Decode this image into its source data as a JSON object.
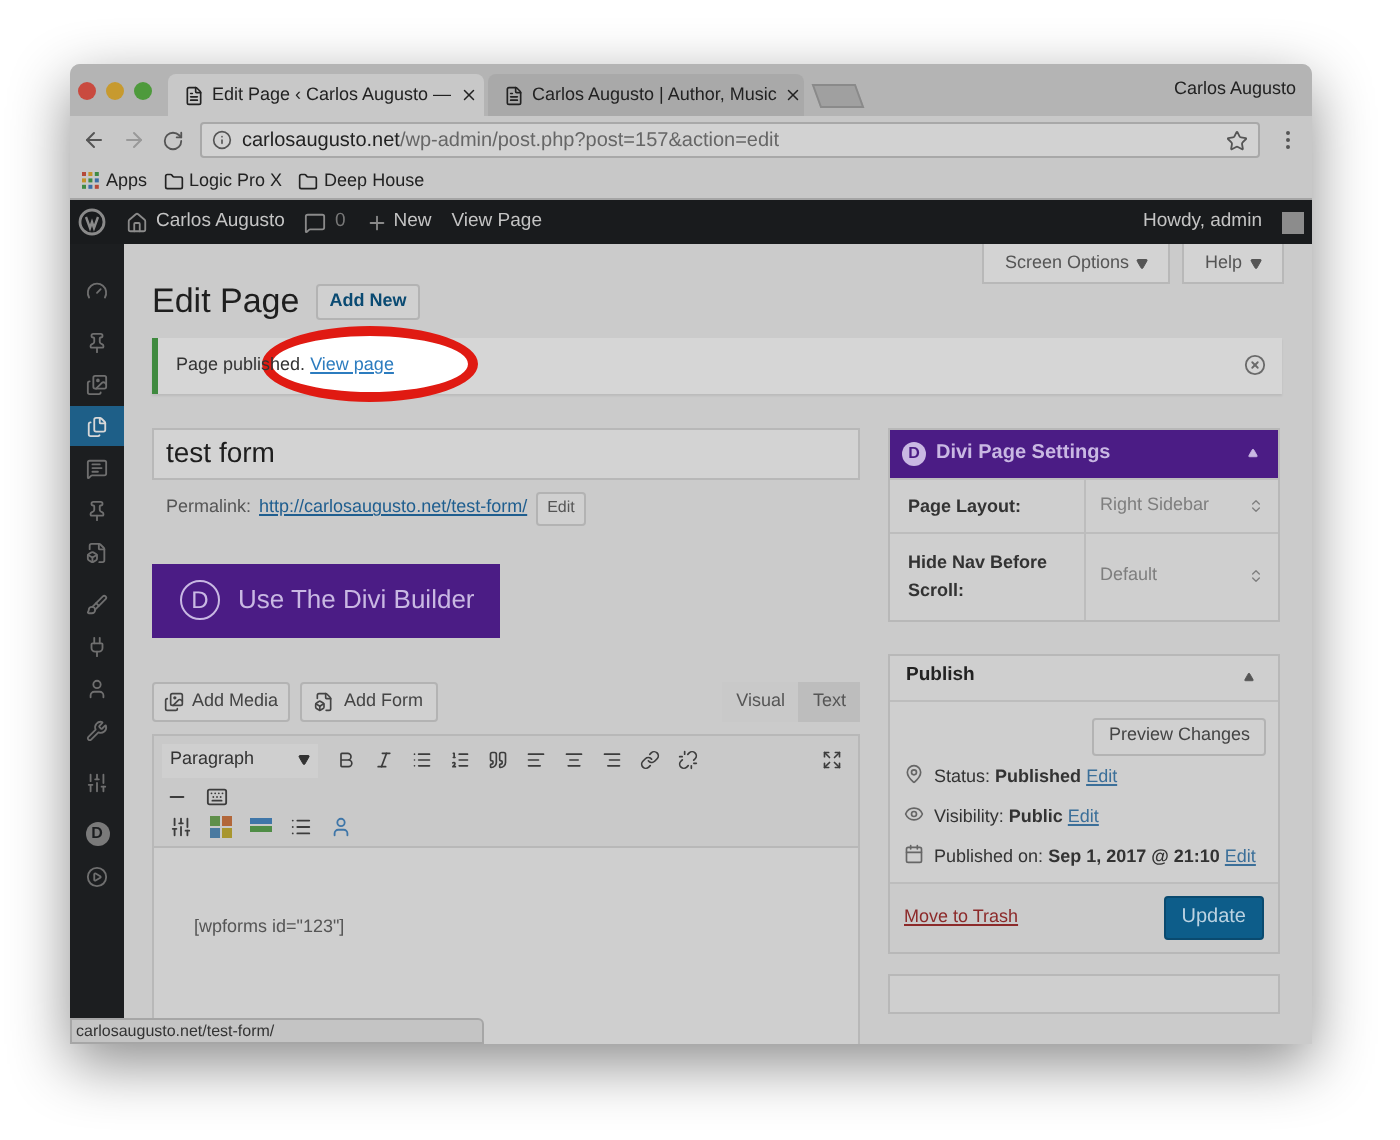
{
  "browser": {
    "tabs": [
      {
        "title": "Edit Page ‹ Carlos Augusto —",
        "selected": true
      },
      {
        "title": "Carlos Augusto | Author, Music",
        "selected": false
      }
    ],
    "profile_name": "Carlos Augusto",
    "url": {
      "domain": "carlosaugusto.net",
      "path": "/wp-admin/post.php?post=157&action=edit"
    },
    "bookmarks": [
      {
        "label": "Apps",
        "kind": "apps"
      },
      {
        "label": "Logic Pro X",
        "kind": "folder"
      },
      {
        "label": "Deep House",
        "kind": "folder"
      }
    ]
  },
  "admin_bar": {
    "site_name": "Carlos Augusto",
    "comments_count": "0",
    "new_label": "New",
    "view_page": "View Page",
    "greeting": "Howdy, admin"
  },
  "admin_menu": [
    {
      "kind": "dashboard",
      "selected": false
    },
    {
      "kind": "pin",
      "selected": false
    },
    {
      "kind": "media",
      "selected": false
    },
    {
      "kind": "pages",
      "selected": true
    },
    {
      "kind": "comments",
      "selected": false
    },
    {
      "kind": "pin",
      "selected": false
    },
    {
      "kind": "form",
      "selected": false
    },
    {
      "kind": "appearance",
      "selected": false
    },
    {
      "kind": "plugins",
      "selected": false
    },
    {
      "kind": "users",
      "selected": false
    },
    {
      "kind": "tools",
      "selected": false
    },
    {
      "kind": "settings",
      "selected": false
    },
    {
      "kind": "divi",
      "logo": "D",
      "selected": false
    },
    {
      "kind": "play",
      "selected": false
    }
  ],
  "screen_options": "Screen Options",
  "help": "Help",
  "heading": "Edit Page",
  "add_new": "Add New",
  "notice": {
    "text": "Page published.",
    "link": "View page",
    "highlighted": true
  },
  "title_field": {
    "value": "test form"
  },
  "permalink": {
    "label": "Permalink:",
    "url": "http://carlosaugusto.net/test-form/",
    "edit": "Edit"
  },
  "divi_builder": {
    "logo": "D",
    "label": "Use The Divi Builder"
  },
  "editor": {
    "add_media": "Add Media",
    "add_form": "Add Form",
    "tabs": [
      {
        "label": "Visual",
        "selected": true
      },
      {
        "label": "Text",
        "selected": false
      }
    ],
    "format": "Paragraph",
    "content": "[wpforms id=\"123\"]"
  },
  "divi_settings": {
    "logo": "D",
    "title": "Divi Page Settings",
    "fields": [
      {
        "label": "Page Layout:",
        "value": "Right Sidebar"
      },
      {
        "label": "Hide Nav Before Scroll:",
        "value": "Default"
      }
    ]
  },
  "publish": {
    "title": "Publish",
    "preview": "Preview Changes",
    "rows": [
      {
        "kind": "status",
        "label": "Status:",
        "value": "Published",
        "edit": "Edit"
      },
      {
        "kind": "visibility",
        "label": "Visibility:",
        "value": "Public",
        "edit": "Edit"
      },
      {
        "kind": "date",
        "label": "Published on:",
        "value": "Sep 1, 2017 @ 21:10",
        "edit": "Edit"
      }
    ],
    "trash": "Move to Trash",
    "update": "Update"
  },
  "status_tooltip": "carlosaugusto.net/test-form/"
}
